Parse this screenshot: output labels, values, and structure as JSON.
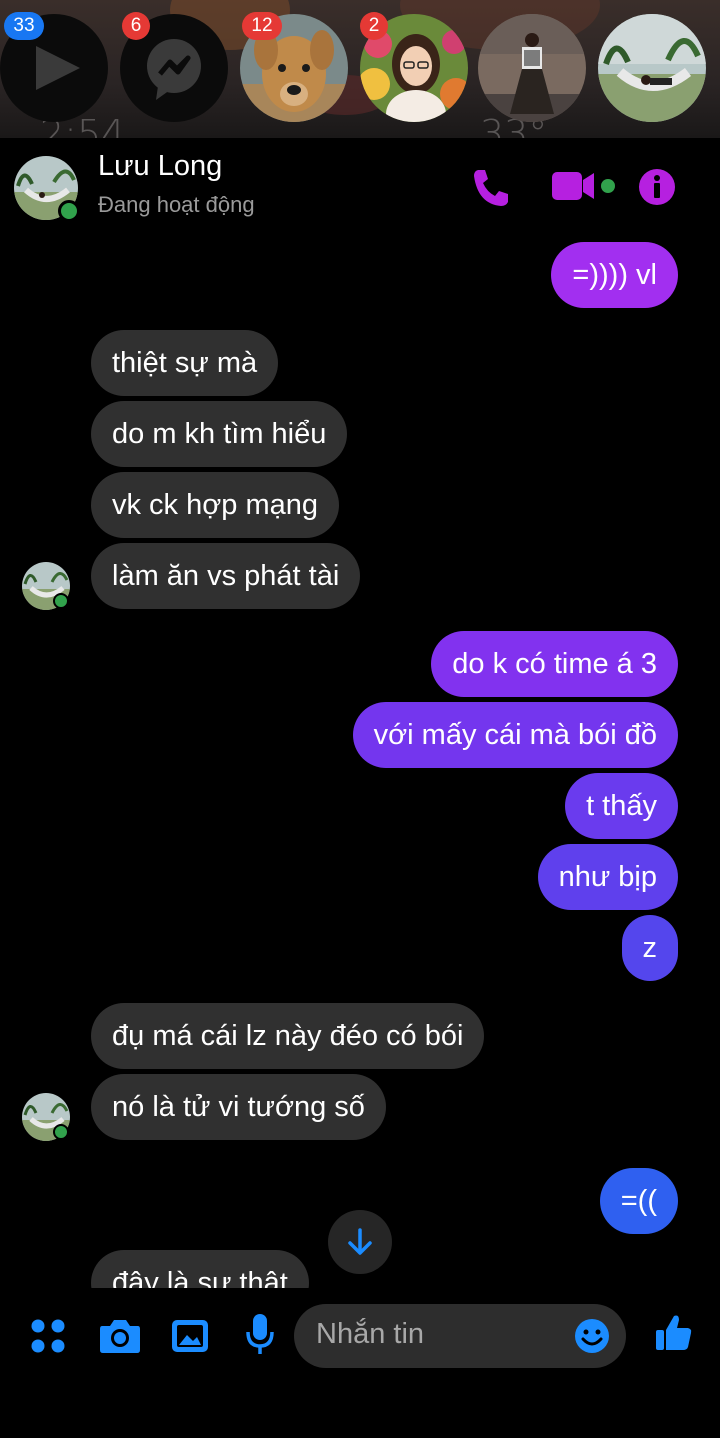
{
  "chat_heads": [
    {
      "name": "video-app",
      "badge": "33",
      "badge_color": "#1877f2"
    },
    {
      "name": "messenger",
      "badge": "6",
      "badge_color": "#e53935"
    },
    {
      "name": "dog-contact",
      "badge": "12",
      "badge_color": "#e53935"
    },
    {
      "name": "girl-contact",
      "badge": "2",
      "badge_color": "#e53935"
    },
    {
      "name": "person-standing",
      "badge": "",
      "badge_color": ""
    },
    {
      "name": "hammock-contact",
      "badge": "",
      "badge_color": ""
    }
  ],
  "header": {
    "name": "Lưu Long",
    "status": "Đang hoạt động",
    "accent": "#b620e0"
  },
  "messages": [
    {
      "side": "sent",
      "text": "=)))) vl",
      "color": "#a22ff0"
    },
    {
      "side": "recv",
      "text": "thiệt sự mà"
    },
    {
      "side": "recv",
      "text": "do m kh tìm hiểu"
    },
    {
      "side": "recv",
      "text": "vk ck hợp mạng"
    },
    {
      "side": "recv",
      "text": "làm ăn vs phát tài"
    },
    {
      "side": "sent",
      "text": "do k có time á 3",
      "color": "#8232ef"
    },
    {
      "side": "sent",
      "text": "với mấy cái mà bói đồ",
      "color": "#7436ee"
    },
    {
      "side": "sent",
      "text": "t thấy",
      "color": "#6a3bee"
    },
    {
      "side": "sent",
      "text": "như bịp",
      "color": "#5f40ed"
    },
    {
      "side": "sent",
      "text": "z",
      "color": "#5446ed"
    },
    {
      "side": "recv",
      "text": "đụ má cái lz này đéo có bói"
    },
    {
      "side": "recv",
      "text": "nó là tử vi tướng số"
    },
    {
      "side": "sent",
      "text": "=((",
      "color": "#2f60f0"
    },
    {
      "side": "recv",
      "text": "đây là sự thật"
    }
  ],
  "composer": {
    "placeholder": "Nhắn tin",
    "accent": "#1b8cff"
  }
}
